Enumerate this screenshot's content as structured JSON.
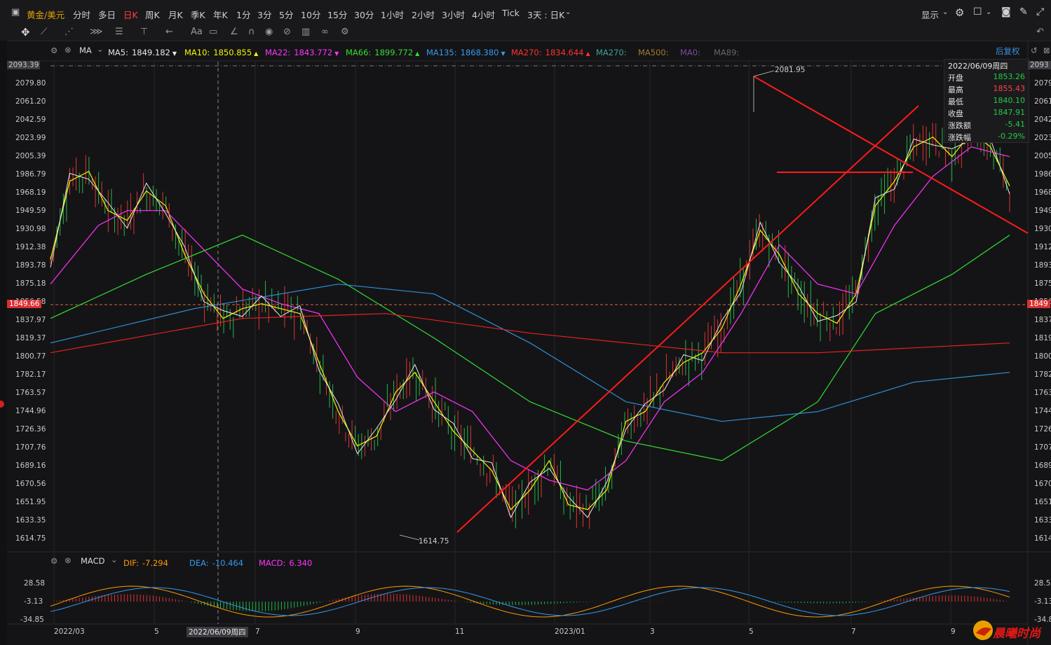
{
  "topbar": {
    "symbol": "黄金/美元",
    "periods": [
      "分时",
      "多日",
      "日K",
      "周K",
      "月K",
      "季K",
      "年K",
      "1分",
      "3分",
      "5分",
      "10分",
      "15分",
      "30分",
      "1小时",
      "2小时",
      "3小时",
      "4小时",
      "Tick",
      "3天 : 日K"
    ],
    "active_period": "日K",
    "display_label": "显示"
  },
  "indicator_ma": {
    "name": "MA",
    "items": [
      {
        "label": "MA5:",
        "value": "1849.182",
        "color": "#e8e8e8"
      },
      {
        "label": "MA10:",
        "value": "1850.855",
        "color": "#f5f500"
      },
      {
        "label": "MA22:",
        "value": "1843.772",
        "color": "#ff33ff"
      },
      {
        "label": "MA66:",
        "value": "1899.772",
        "color": "#33dd33"
      },
      {
        "label": "MA135:",
        "value": "1868.380",
        "color": "#3399ee"
      },
      {
        "label": "MA270:",
        "value": "1834.644",
        "color": "#ff3030"
      },
      {
        "label": "MA270:",
        "value": "",
        "color": "#3aa0a0"
      },
      {
        "label": "MA500:",
        "value": "",
        "color": "#a07a30"
      },
      {
        "label": "MA0:",
        "value": "",
        "color": "#7a4aa0"
      },
      {
        "label": "MA89:",
        "value": "",
        "color": "#666666"
      }
    ],
    "adjust_label": "后复权"
  },
  "price_axis": [
    "2093.39",
    "2079.80",
    "2061.20",
    "2042.59",
    "2023.99",
    "2005.39",
    "1986.79",
    "1968.19",
    "1949.59",
    "1930.98",
    "1912.38",
    "1893.78",
    "1875.18",
    "1856.58",
    "1837.97",
    "1819.37",
    "1800.77",
    "1782.17",
    "1763.57",
    "1744.96",
    "1726.36",
    "1707.76",
    "1689.16",
    "1670.56",
    "1651.95",
    "1633.35",
    "1614.75"
  ],
  "price_right": [
    "2093",
    "2079",
    "2061",
    "2042",
    "2023",
    "2005",
    "1986",
    "1968",
    "1949",
    "1930",
    "1912",
    "1893",
    "1875",
    "1856",
    "1837",
    "1819",
    "1800",
    "1782",
    "1763",
    "1744",
    "1726",
    "1707",
    "1689",
    "1670",
    "1651",
    "1633",
    "1614"
  ],
  "cursor_price": "1849.66",
  "cursor_price_right": "1849",
  "high_marker": "2081.95",
  "low_marker": "1614.75",
  "infobox": {
    "date": "2022/06/09周四",
    "rows": [
      {
        "k": "开盘",
        "v": "1853.26",
        "color": "#22cc44"
      },
      {
        "k": "最高",
        "v": "1855.43",
        "color": "#ff4444"
      },
      {
        "k": "最低",
        "v": "1840.10",
        "color": "#22cc44"
      },
      {
        "k": "收盘",
        "v": "1847.91",
        "color": "#22cc44"
      },
      {
        "k": "涨跌额",
        "v": "-5.41",
        "color": "#22cc44"
      },
      {
        "k": "涨跌幅",
        "v": "-0.29%",
        "color": "#22cc44"
      }
    ]
  },
  "indicator_macd": {
    "name": "MACD",
    "items": [
      {
        "label": "DIF:",
        "value": "-7.294",
        "color": "#ff9900"
      },
      {
        "label": "DEA:",
        "value": "-10.464",
        "color": "#3399ee"
      },
      {
        "label": "MACD:",
        "value": "6.340",
        "color": "#ff33ff"
      }
    ],
    "axis": [
      "28.58",
      "-3.13",
      "-34.85"
    ],
    "axis_right": [
      "28.58",
      "-3.13",
      "-34.8"
    ]
  },
  "x_axis": [
    {
      "label": "2022/03"
    },
    {
      "label": "5"
    },
    {
      "label": "7"
    },
    {
      "label": "9"
    },
    {
      "label": "11"
    },
    {
      "label": "2023/01"
    },
    {
      "label": "3"
    },
    {
      "label": "5"
    },
    {
      "label": "7"
    },
    {
      "label": "9"
    }
  ],
  "cursor_date": "2022/06/09周四",
  "brand": "晨曦时尚",
  "chart_data": {
    "type": "candlestick",
    "title": "",
    "ylim": [
      1614.75,
      2093.39
    ],
    "series": [
      {
        "name": "MA5",
        "color": "#e8e8e8",
        "last": 1849.182
      },
      {
        "name": "MA10",
        "color": "#f5f500",
        "last": 1850.855
      },
      {
        "name": "MA22",
        "color": "#ff33ff",
        "last": 1843.772
      },
      {
        "name": "MA66",
        "color": "#33dd33",
        "last": 1899.772
      },
      {
        "name": "MA135",
        "color": "#3399ee",
        "last": 1868.38
      },
      {
        "name": "MA270",
        "color": "#ff3030",
        "last": 1834.644
      }
    ],
    "ma10_path": [
      [
        0,
        1895
      ],
      [
        0.02,
        1975
      ],
      [
        0.04,
        1985
      ],
      [
        0.06,
        1945
      ],
      [
        0.08,
        1935
      ],
      [
        0.1,
        1965
      ],
      [
        0.12,
        1950
      ],
      [
        0.14,
        1900
      ],
      [
        0.16,
        1860
      ],
      [
        0.18,
        1835
      ],
      [
        0.2,
        1845
      ],
      [
        0.22,
        1850
      ],
      [
        0.24,
        1845
      ],
      [
        0.26,
        1840
      ],
      [
        0.28,
        1790
      ],
      [
        0.3,
        1740
      ],
      [
        0.32,
        1705
      ],
      [
        0.34,
        1715
      ],
      [
        0.36,
        1760
      ],
      [
        0.38,
        1780
      ],
      [
        0.4,
        1750
      ],
      [
        0.42,
        1720
      ],
      [
        0.44,
        1700
      ],
      [
        0.46,
        1680
      ],
      [
        0.48,
        1640
      ],
      [
        0.5,
        1660
      ],
      [
        0.52,
        1690
      ],
      [
        0.54,
        1645
      ],
      [
        0.56,
        1640
      ],
      [
        0.58,
        1660
      ],
      [
        0.6,
        1730
      ],
      [
        0.62,
        1740
      ],
      [
        0.64,
        1770
      ],
      [
        0.66,
        1790
      ],
      [
        0.68,
        1800
      ],
      [
        0.7,
        1825
      ],
      [
        0.72,
        1870
      ],
      [
        0.74,
        1925
      ],
      [
        0.76,
        1900
      ],
      [
        0.78,
        1860
      ],
      [
        0.8,
        1840
      ],
      [
        0.82,
        1830
      ],
      [
        0.84,
        1860
      ],
      [
        0.86,
        1950
      ],
      [
        0.88,
        1975
      ],
      [
        0.9,
        2010
      ],
      [
        0.92,
        2020
      ],
      [
        0.94,
        2000
      ],
      [
        0.96,
        2025
      ],
      [
        0.98,
        2010
      ],
      [
        1,
        1970
      ]
    ],
    "ma22_path": [
      [
        0,
        1870
      ],
      [
        0.05,
        1930
      ],
      [
        0.08,
        1945
      ],
      [
        0.12,
        1945
      ],
      [
        0.16,
        1905
      ],
      [
        0.2,
        1865
      ],
      [
        0.24,
        1850
      ],
      [
        0.28,
        1840
      ],
      [
        0.32,
        1775
      ],
      [
        0.36,
        1740
      ],
      [
        0.4,
        1760
      ],
      [
        0.44,
        1740
      ],
      [
        0.48,
        1690
      ],
      [
        0.52,
        1670
      ],
      [
        0.56,
        1660
      ],
      [
        0.6,
        1690
      ],
      [
        0.64,
        1750
      ],
      [
        0.68,
        1780
      ],
      [
        0.72,
        1840
      ],
      [
        0.76,
        1910
      ],
      [
        0.8,
        1870
      ],
      [
        0.84,
        1860
      ],
      [
        0.88,
        1930
      ],
      [
        0.92,
        1980
      ],
      [
        0.96,
        2010
      ],
      [
        1,
        2000
      ]
    ],
    "ma66_path": [
      [
        0,
        1835
      ],
      [
        0.1,
        1880
      ],
      [
        0.2,
        1920
      ],
      [
        0.3,
        1875
      ],
      [
        0.4,
        1815
      ],
      [
        0.5,
        1750
      ],
      [
        0.6,
        1710
      ],
      [
        0.7,
        1690
      ],
      [
        0.8,
        1750
      ],
      [
        0.86,
        1840
      ],
      [
        0.94,
        1880
      ],
      [
        1,
        1920
      ]
    ],
    "ma135_path": [
      [
        0,
        1810
      ],
      [
        0.15,
        1845
      ],
      [
        0.3,
        1870
      ],
      [
        0.4,
        1860
      ],
      [
        0.5,
        1810
      ],
      [
        0.6,
        1750
      ],
      [
        0.7,
        1730
      ],
      [
        0.8,
        1740
      ],
      [
        0.9,
        1770
      ],
      [
        1,
        1780
      ]
    ],
    "ma270_path": [
      [
        0,
        1800
      ],
      [
        0.2,
        1835
      ],
      [
        0.35,
        1840
      ],
      [
        0.5,
        1820
      ],
      [
        0.6,
        1810
      ],
      [
        0.7,
        1800
      ],
      [
        0.8,
        1800
      ],
      [
        0.9,
        1805
      ],
      [
        1,
        1810
      ]
    ]
  }
}
